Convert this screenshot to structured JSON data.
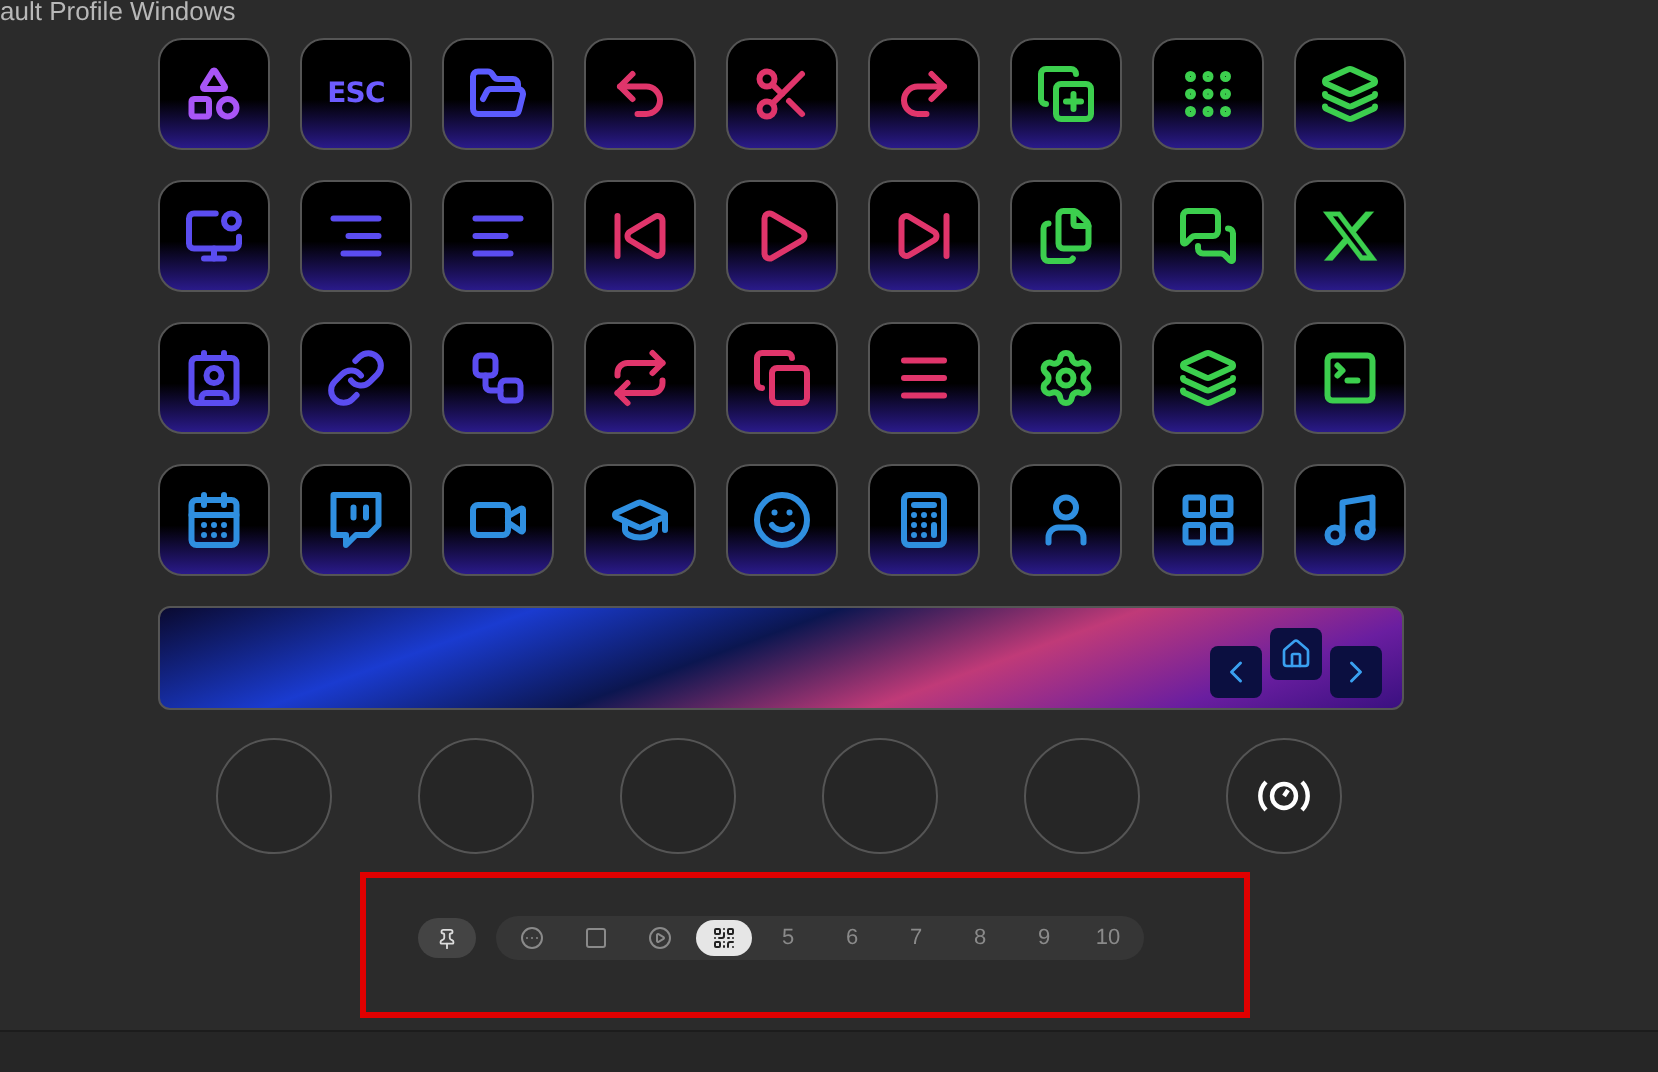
{
  "window": {
    "title": "ault Profile Windows"
  },
  "keys": [
    {
      "kind": "icon",
      "color": "#a855f7"
    },
    {
      "kind": "text",
      "label": "ESC",
      "color": "#6d5cff"
    },
    {
      "kind": "icon",
      "color": "#5b5bff"
    },
    {
      "kind": "icon",
      "color": "#e0356b"
    },
    {
      "kind": "icon",
      "color": "#e0356b"
    },
    {
      "kind": "icon",
      "color": "#e0356b"
    },
    {
      "kind": "icon",
      "color": "#3ccf4e"
    },
    {
      "kind": "icon",
      "color": "#3ccf4e"
    },
    {
      "kind": "icon",
      "color": "#3ccf4e"
    },
    {
      "kind": "icon",
      "color": "#5b4df0"
    },
    {
      "kind": "icon",
      "color": "#5b4df0"
    },
    {
      "kind": "icon",
      "color": "#5b4df0"
    },
    {
      "kind": "icon",
      "color": "#e0356b"
    },
    {
      "kind": "icon",
      "color": "#e0356b"
    },
    {
      "kind": "icon",
      "color": "#e0356b"
    },
    {
      "kind": "icon",
      "color": "#3ccf4e"
    },
    {
      "kind": "icon",
      "color": "#3ccf4e"
    },
    {
      "kind": "icon",
      "color": "#3ccf4e"
    },
    {
      "kind": "icon",
      "color": "#5b4df0"
    },
    {
      "kind": "icon",
      "color": "#5b4df0"
    },
    {
      "kind": "icon",
      "color": "#5b4df0"
    },
    {
      "kind": "icon",
      "color": "#e0356b"
    },
    {
      "kind": "icon",
      "color": "#e0356b"
    },
    {
      "kind": "icon",
      "color": "#e0356b"
    },
    {
      "kind": "icon",
      "color": "#3ccf4e"
    },
    {
      "kind": "icon",
      "color": "#3ccf4e"
    },
    {
      "kind": "icon",
      "color": "#3ccf4e"
    },
    {
      "kind": "icon",
      "color": "#2f8fe0"
    },
    {
      "kind": "icon",
      "color": "#2f8fe0"
    },
    {
      "kind": "icon",
      "color": "#2f8fe0"
    },
    {
      "kind": "icon",
      "color": "#2f8fe0"
    },
    {
      "kind": "icon",
      "color": "#2f8fe0"
    },
    {
      "kind": "icon",
      "color": "#2f8fe0"
    },
    {
      "kind": "icon",
      "color": "#2f8fe0"
    },
    {
      "kind": "icon",
      "color": "#2f8fe0"
    },
    {
      "kind": "icon",
      "color": "#2f8fe0"
    }
  ],
  "dials": [
    {
      "kind": "empty"
    },
    {
      "kind": "empty"
    },
    {
      "kind": "empty"
    },
    {
      "kind": "empty"
    },
    {
      "kind": "empty"
    },
    {
      "kind": "dial"
    }
  ],
  "pages": [
    {
      "kind": "icon",
      "selected": false
    },
    {
      "kind": "icon",
      "selected": false
    },
    {
      "kind": "icon",
      "selected": false
    },
    {
      "kind": "icon",
      "selected": true
    },
    {
      "kind": "number",
      "label": "5",
      "selected": false
    },
    {
      "kind": "number",
      "label": "6",
      "selected": false
    },
    {
      "kind": "number",
      "label": "7",
      "selected": false
    },
    {
      "kind": "number",
      "label": "8",
      "selected": false
    },
    {
      "kind": "number",
      "label": "9",
      "selected": false
    },
    {
      "kind": "number",
      "label": "10",
      "selected": false
    }
  ],
  "highlight": {
    "shown": true
  }
}
